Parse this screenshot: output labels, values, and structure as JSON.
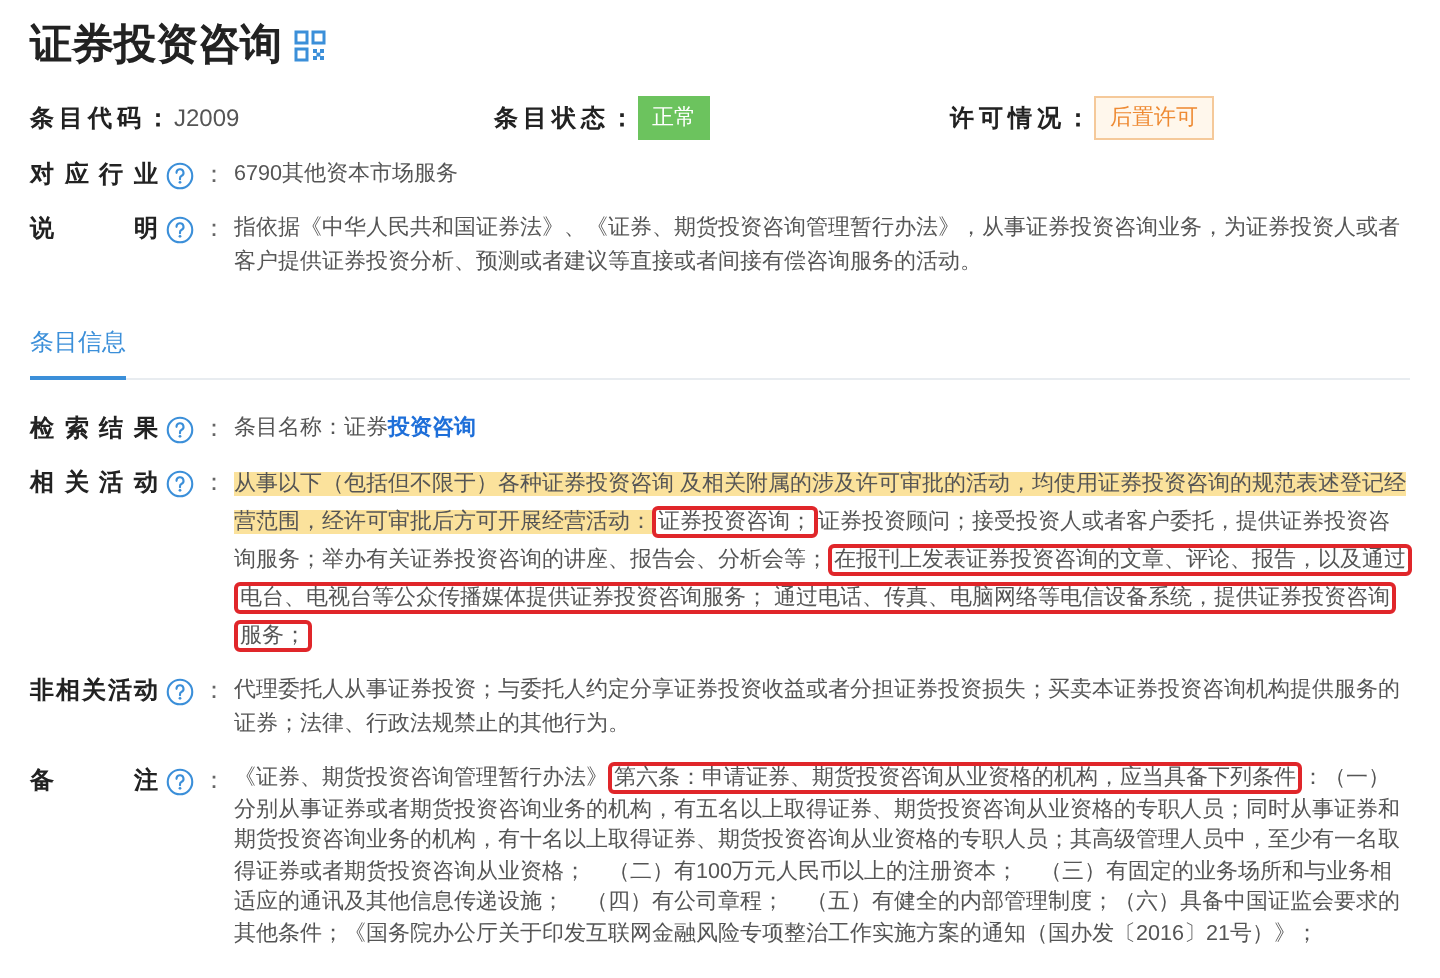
{
  "title": "证券投资咨询",
  "summary": [
    {
      "label": "条目代码：",
      "value": "J2009",
      "kind": "plain"
    },
    {
      "label": "条目状态：",
      "value": "正常",
      "kind": "success"
    },
    {
      "label": "许可情况：",
      "value": "后置许可",
      "kind": "warning"
    }
  ],
  "details": [
    {
      "label": "对应行业",
      "colon": "：",
      "segments": [
        {
          "text": "6790其他资本市场服务",
          "kind": "plain"
        }
      ]
    },
    {
      "label": "说明",
      "colon": "：",
      "segments": [
        {
          "text": "指依据《中华人民共和国证券法》、《证券、期货投资咨询管理暂行办法》，从事证券投资咨询业务，为证券投资人或者客户提供证券投资分析、预测或者建议等直接或者间接有偿咨询服务的活动。",
          "kind": "plain"
        }
      ]
    }
  ],
  "tabs": [
    {
      "label": "条目信息",
      "selected": true
    }
  ],
  "sections": [
    {
      "label": "检索结果",
      "colon": "：",
      "segments": [
        {
          "text": "条目名称：证券",
          "kind": "plain"
        },
        {
          "text": "投资咨询",
          "kind": "emphasis"
        }
      ]
    },
    {
      "label": "相关活动",
      "colon": "：",
      "segments": [
        {
          "text": "从事以下（包括但不限于）各种证券投资咨询 及相关附属的涉及许可审批的活动，均使用证券投资咨询的规范表述登记经营范围，经许可审批后方可开展经营活动：",
          "kind": "highlight"
        },
        {
          "text": "证券投资咨询；",
          "kind": "boxed"
        },
        {
          "text": "证券投资顾问；接受投资人或者客户委托，提供证券投资咨询服务；举办有关证券投资咨询的讲座、报告会、分析会等；",
          "kind": "plain"
        },
        {
          "text": "在报刊上发表证券投资咨询的文章、评论、报告，以及通过电台、电视台等公众传播媒体提供证券投资咨询服务； 通过电话、传真、电脑网络等电信设备系统，提供证券投资咨询服务；",
          "kind": "boxed"
        }
      ]
    },
    {
      "label": "非相关活动",
      "colon": "：",
      "segments": [
        {
          "text": "代理委托人从事证券投资；与委托人约定分享证券投资收益或者分担证券投资损失；买卖本证券投资咨询机构提供服务的证券；法律、行政法规禁止的其他行为。",
          "kind": "plain"
        }
      ]
    },
    {
      "label": "备注",
      "colon": "：",
      "segments": [
        {
          "text": "《证券、期货投资咨询管理暂行办法》",
          "kind": "plain"
        },
        {
          "text": "第六条：申请证券、期货投资咨询从业资格的机构，应当具备下列条件",
          "kind": "boxed"
        },
        {
          "text": "：（一）分别从事证券或者期货投资咨询业务的机构，有五名以上取得证券、期货投资咨询从业资格的专职人员；同时从事证券和期货投资咨询业务的机构，有十名以上取得证券、期货投资咨询从业资格的专职人员；其高级管理人员中，至少有一名取得证券或者期货投资咨询从业资格；　（二）有100万元人民币以上的注册资本；　（三）有固定的业务场所和与业务相适应的通讯及其他信息传递设施；　（四）有公司章程；　（五）有健全的内部管理制度；（六）具备中国证监会要求的其他条件；《国务院办公厅关于印发互联网金融风险专项整治工作实施方案的通知（国办发〔2016〕21号）》；",
          "kind": "plain"
        }
      ]
    }
  ]
}
